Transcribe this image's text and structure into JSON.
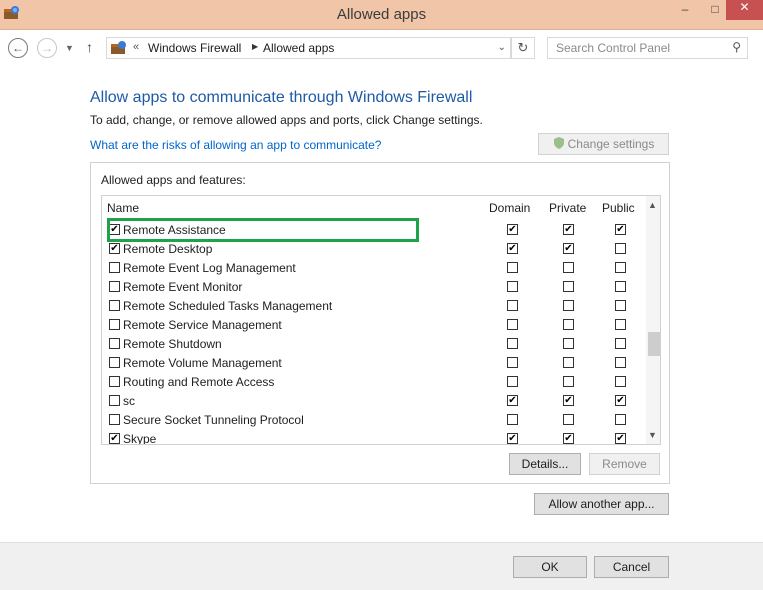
{
  "window": {
    "title": "Allowed apps"
  },
  "address": {
    "more": "«",
    "crumbs": [
      "Windows Firewall",
      "Allowed apps"
    ],
    "search_placeholder": "Search Control Panel"
  },
  "main": {
    "title": "Allow apps to communicate through Windows Firewall",
    "subtitle": "To add, change, or remove allowed apps and ports, click Change settings.",
    "risk_link": "What are the risks of allowing an app to communicate?",
    "change_settings": "Change settings"
  },
  "panel": {
    "label": "Allowed apps and features:",
    "columns": {
      "name": "Name",
      "domain": "Domain",
      "private": "Private",
      "public": "Public"
    },
    "rows": [
      {
        "name": "Remote Assistance",
        "enabled": "✔",
        "domain": "✔",
        "private": "✔",
        "public": "✔"
      },
      {
        "name": "Remote Desktop",
        "enabled": "✔",
        "domain": "✔",
        "private": "✔",
        "public": ""
      },
      {
        "name": "Remote Event Log Management",
        "enabled": "",
        "domain": "",
        "private": "",
        "public": ""
      },
      {
        "name": "Remote Event Monitor",
        "enabled": "",
        "domain": "",
        "private": "",
        "public": ""
      },
      {
        "name": "Remote Scheduled Tasks Management",
        "enabled": "",
        "domain": "",
        "private": "",
        "public": ""
      },
      {
        "name": "Remote Service Management",
        "enabled": "",
        "domain": "",
        "private": "",
        "public": ""
      },
      {
        "name": "Remote Shutdown",
        "enabled": "",
        "domain": "",
        "private": "",
        "public": ""
      },
      {
        "name": "Remote Volume Management",
        "enabled": "",
        "domain": "",
        "private": "",
        "public": ""
      },
      {
        "name": "Routing and Remote Access",
        "enabled": "",
        "domain": "",
        "private": "",
        "public": ""
      },
      {
        "name": "sc",
        "enabled": "",
        "domain": "✔",
        "private": "✔",
        "public": "✔"
      },
      {
        "name": "Secure Socket Tunneling Protocol",
        "enabled": "",
        "domain": "",
        "private": "",
        "public": ""
      },
      {
        "name": "Skype",
        "enabled": "✔",
        "domain": "✔",
        "private": "✔",
        "public": "✔"
      }
    ],
    "details_button": "Details...",
    "remove_button": "Remove"
  },
  "allow_another_button": "Allow another app...",
  "footer": {
    "ok": "OK",
    "cancel": "Cancel"
  },
  "colors": {
    "titlebar": "#f1c5a7",
    "title_text": "#1e5aa5",
    "link": "#0066cc",
    "highlight": "#1fa34a"
  }
}
